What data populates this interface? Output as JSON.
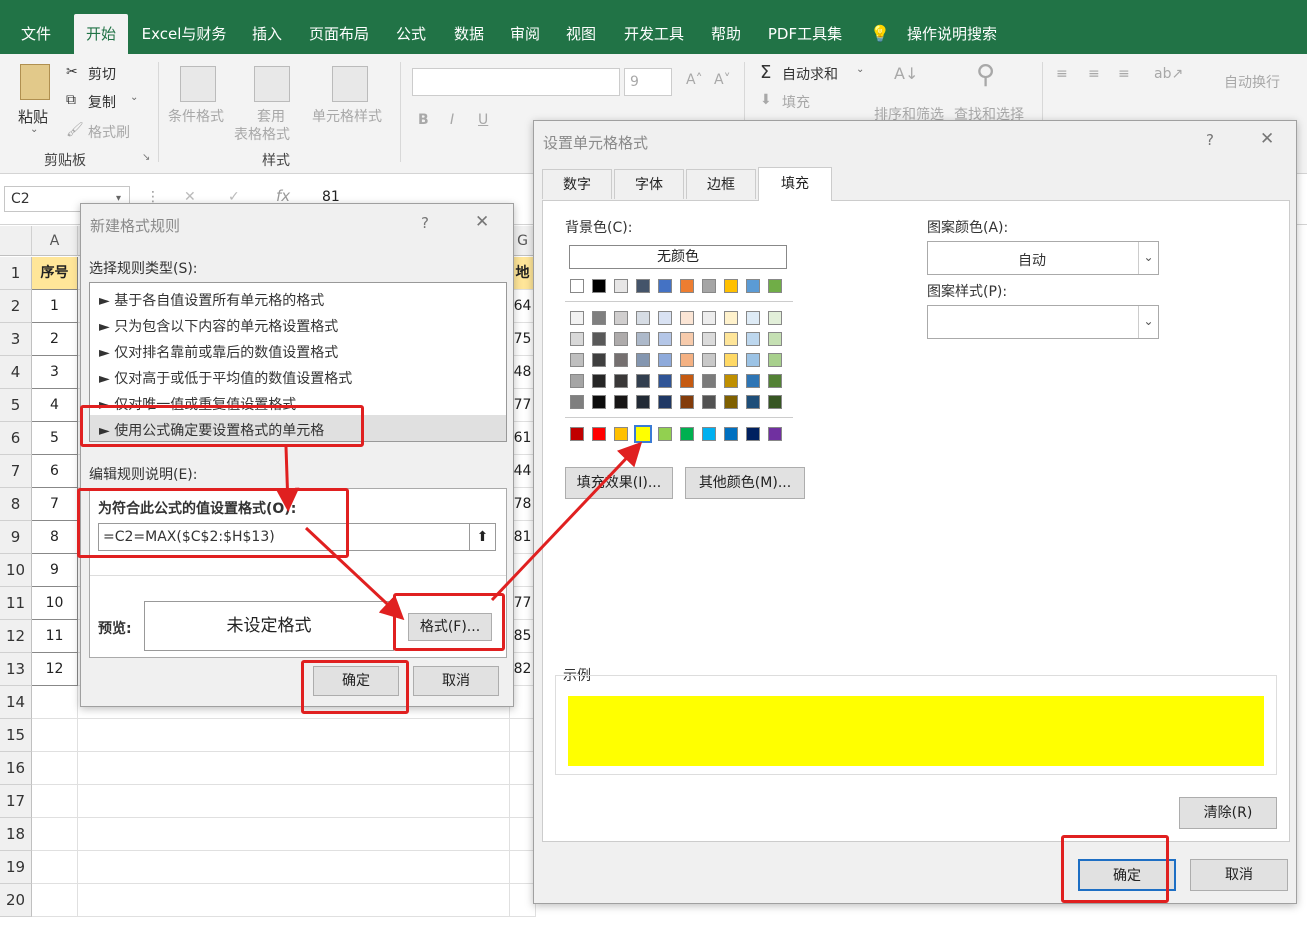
{
  "ribbon_tabs": [
    {
      "label": "文件",
      "active": false
    },
    {
      "label": "开始",
      "active": true
    },
    {
      "label": "Excel与财务",
      "active": false
    },
    {
      "label": "插入",
      "active": false
    },
    {
      "label": "页面布局",
      "active": false
    },
    {
      "label": "公式",
      "active": false
    },
    {
      "label": "数据",
      "active": false
    },
    {
      "label": "审阅",
      "active": false
    },
    {
      "label": "视图",
      "active": false
    },
    {
      "label": "开发工具",
      "active": false
    },
    {
      "label": "帮助",
      "active": false
    },
    {
      "label": "PDF工具集",
      "active": false
    },
    {
      "label": "操作说明搜索",
      "active": false
    }
  ],
  "ribbon": {
    "paste": "粘贴",
    "cut": "剪切",
    "copy": "复制",
    "format_painter": "格式刷",
    "clipboard_group": "剪贴板",
    "cond_format": "条件格式",
    "table_format_1": "套用",
    "table_format_2": "表格格式",
    "cell_styles": "单元格样式",
    "styles_group": "样式",
    "font_size": "9",
    "autosum": "自动求和",
    "fill": "填充",
    "sort_filter": "排序和筛选",
    "find_select": "查找和选择",
    "wrap_text": "自动换行",
    "bold": "B",
    "italic": "I",
    "underline": "U"
  },
  "formula_bar": {
    "name_box": "C2",
    "fx": "fx",
    "value": "81"
  },
  "sheet": {
    "col_a": "A",
    "col_g": "G",
    "header_a": "序号",
    "header_g": "地理",
    "rows": [
      "1",
      "2",
      "3",
      "4",
      "5",
      "6",
      "7",
      "8",
      "9",
      "10",
      "11",
      "12",
      "13",
      "14",
      "15",
      "16",
      "17",
      "18",
      "19",
      "20"
    ],
    "col_a_values": [
      "1",
      "2",
      "3",
      "4",
      "5",
      "6",
      "7",
      "8",
      "9",
      "10",
      "11",
      "12"
    ],
    "col_g_values": [
      "64",
      "75",
      "48",
      "77",
      "61",
      "44",
      "78",
      "81",
      "",
      "77",
      "85",
      "82"
    ]
  },
  "rule_dialog": {
    "title": "新建格式规则",
    "help": "?",
    "select_type_label": "选择规则类型(S):",
    "rule_types": [
      "► 基于各自值设置所有单元格的格式",
      "► 只为包含以下内容的单元格设置格式",
      "► 仅对排名靠前或靠后的数值设置格式",
      "► 仅对高于或低于平均值的数值设置格式",
      "► 仅对唯一值或重复值设置格式",
      "► 使用公式确定要设置格式的单元格"
    ],
    "edit_label": "编辑规则说明(E):",
    "formula_label": "为符合此公式的值设置格式(O):",
    "formula": "=C2=MAX($C$2:$H$13)",
    "preview_label": "预览:",
    "preview_text": "未设定格式",
    "format_btn": "格式(F)...",
    "ok": "确定",
    "cancel": "取消"
  },
  "cell_dialog": {
    "title": "设置单元格格式",
    "help": "?",
    "tabs": [
      "数字",
      "字体",
      "边框",
      "填充"
    ],
    "bg_label": "背景色(C):",
    "no_color": "无颜色",
    "fill_effects": "填充效果(I)...",
    "more_colors": "其他颜色(M)...",
    "pattern_color_label": "图案颜色(A):",
    "pattern_color": "自动",
    "pattern_style_label": "图案样式(P):",
    "sample_label": "示例",
    "sample_color": "#ffff00",
    "clear": "清除(R)",
    "ok": "确定",
    "cancel": "取消"
  },
  "palette": {
    "theme_top": [
      "#ffffff",
      "#000000",
      "#e7e6e6",
      "#44546a",
      "#4472c4",
      "#ed7d31",
      "#a5a5a5",
      "#ffc000",
      "#5b9bd5",
      "#70ad47"
    ],
    "theme_tints": [
      [
        "#f2f2f2",
        "#7f7f7f",
        "#d0cece",
        "#d6dce4",
        "#d9e2f3",
        "#fbe5d5",
        "#ededed",
        "#fff2cc",
        "#deebf6",
        "#e2efd9"
      ],
      [
        "#d8d8d8",
        "#595959",
        "#aeabab",
        "#adb9ca",
        "#b4c6e7",
        "#f7cbac",
        "#dbdbdb",
        "#fee599",
        "#bdd7ee",
        "#c5e0b3"
      ],
      [
        "#bfbfbf",
        "#3f3f3f",
        "#757070",
        "#8496b0",
        "#8eaadb",
        "#f4b183",
        "#c9c9c9",
        "#ffd965",
        "#9cc3e5",
        "#a8d08d"
      ],
      [
        "#a5a5a5",
        "#262626",
        "#3a3838",
        "#323f4f",
        "#2f5496",
        "#c55a11",
        "#7b7b7b",
        "#bf8f00",
        "#2e75b5",
        "#538135"
      ],
      [
        "#7f7f7f",
        "#0c0c0c",
        "#171616",
        "#222a35",
        "#1f3864",
        "#833c0b",
        "#525252",
        "#7f6000",
        "#1e4e79",
        "#375623"
      ]
    ],
    "standard": [
      "#c00000",
      "#ff0000",
      "#ffc000",
      "#ffff00",
      "#92d050",
      "#00b050",
      "#00b0f0",
      "#0070c0",
      "#002060",
      "#7030a0"
    ],
    "selected_standard": "#ffff00"
  }
}
